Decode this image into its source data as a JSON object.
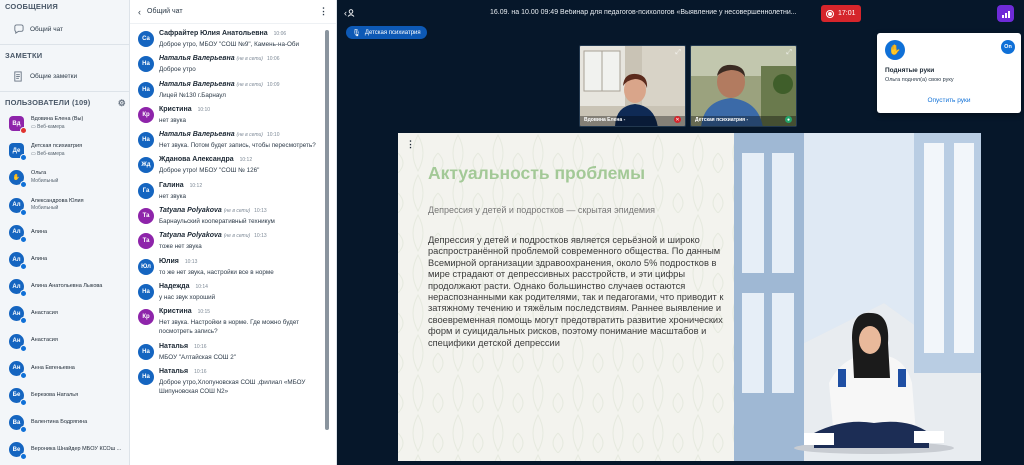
{
  "sidebar": {
    "messages_heading": "СООБЩЕНИЯ",
    "public_chat": "Общий чат",
    "notes_heading": "ЗАМЕТКИ",
    "shared_notes": "Общие заметки",
    "users_heading": "ПОЛЬЗОВАТЕЛИ (109)",
    "users": [
      {
        "initials": "Вд",
        "name": "Вдовина Елена (Вы)",
        "sub": "▭ Веб-камера",
        "color": "#8e24aa",
        "shape": "square",
        "badge": "red"
      },
      {
        "initials": "Де",
        "name": "Детская психиатрия",
        "sub": "▭ Веб-камера",
        "color": "#1565c0",
        "shape": "square",
        "badge": "blue"
      },
      {
        "initials": "✋",
        "name": "Ольга",
        "sub": "Мобильный",
        "color": "#1565c0",
        "shape": "round",
        "badge": "blue"
      },
      {
        "initials": "Ал",
        "name": "Александрова Юлия",
        "sub": "Мобильный",
        "color": "#1565c0",
        "shape": "round",
        "badge": "blue"
      },
      {
        "initials": "Ал",
        "name": "Алина",
        "sub": "",
        "color": "#1565c0",
        "shape": "round",
        "badge": "blue"
      },
      {
        "initials": "Ал",
        "name": "Алина",
        "sub": "",
        "color": "#1565c0",
        "shape": "round",
        "badge": "blue"
      },
      {
        "initials": "Ал",
        "name": "Алина Анатольевна Лыкова",
        "sub": "",
        "color": "#1565c0",
        "shape": "round",
        "badge": "blue"
      },
      {
        "initials": "Ан",
        "name": "Анастасия",
        "sub": "",
        "color": "#1565c0",
        "shape": "round",
        "badge": "blue"
      },
      {
        "initials": "Ан",
        "name": "Анастасия",
        "sub": "",
        "color": "#1565c0",
        "shape": "round",
        "badge": "blue"
      },
      {
        "initials": "Ан",
        "name": "Анна Евгеньевна",
        "sub": "",
        "color": "#1565c0",
        "shape": "round",
        "badge": "blue"
      },
      {
        "initials": "Бе",
        "name": "Березова Наталья",
        "sub": "",
        "color": "#1565c0",
        "shape": "round",
        "badge": "blue"
      },
      {
        "initials": "Ва",
        "name": "Валентина Бодрягина",
        "sub": "",
        "color": "#1565c0",
        "shape": "round",
        "badge": "blue"
      },
      {
        "initials": "Ве",
        "name": "Вероника Шнайдер МБОУ КСОш ...",
        "sub": "",
        "color": "#1565c0",
        "shape": "round",
        "badge": "blue"
      }
    ]
  },
  "chat": {
    "title": "Общий чат",
    "messages": [
      {
        "initials": "Са",
        "color": "#1565c0",
        "name": "Сафрайтер Юлия Анатольевна",
        "status": "",
        "time": "10:06",
        "text": "Доброе утро, МБОУ \"СОШ №9\", Камень-на-Оби",
        "italic": false
      },
      {
        "initials": "На",
        "color": "#1565c0",
        "name": "Наталья Валерьевна",
        "status": "(не в сети)",
        "time": "10:06",
        "text": "Доброе утро",
        "italic": true
      },
      {
        "initials": "На",
        "color": "#1565c0",
        "name": "Наталья Валерьевна",
        "status": "(не в сети)",
        "time": "10:09",
        "text": "Лицей №130 г.Барнаул",
        "italic": true
      },
      {
        "initials": "Кр",
        "color": "#8e24aa",
        "name": "Кристина",
        "status": "",
        "time": "10:10",
        "text": "нет звука",
        "italic": false
      },
      {
        "initials": "На",
        "color": "#1565c0",
        "name": "Наталья Валерьевна",
        "status": "(не в сети)",
        "time": "10:10",
        "text": "Нет звука. Потом будет запись, чтобы пересмотреть?",
        "italic": true
      },
      {
        "initials": "Жд",
        "color": "#1565c0",
        "name": "Жданова Александра",
        "status": "",
        "time": "10:12",
        "text": "Доброе утро! МБОУ \"СОШ № 126\"",
        "italic": false
      },
      {
        "initials": "Га",
        "color": "#1565c0",
        "name": "Галина",
        "status": "",
        "time": "10:12",
        "text": "нет звука",
        "italic": false
      },
      {
        "initials": "Та",
        "color": "#8e24aa",
        "name": "Tatyana Polyakova",
        "status": "(не в сети)",
        "time": "10:13",
        "text": "Барнаульский кооперативный техникум",
        "italic": true
      },
      {
        "initials": "Та",
        "color": "#8e24aa",
        "name": "Tatyana Polyakova",
        "status": "(не в сети)",
        "time": "10:13",
        "text": "тоже нет звука",
        "italic": true
      },
      {
        "initials": "Юл",
        "color": "#1565c0",
        "name": "Юлия",
        "status": "",
        "time": "10:13",
        "text": "то же нет звука, настройки все в норме",
        "italic": false
      },
      {
        "initials": "На",
        "color": "#1565c0",
        "name": "Надежда",
        "status": "",
        "time": "10:14",
        "text": "у нас звук хороший",
        "italic": false
      },
      {
        "initials": "Кр",
        "color": "#8e24aa",
        "name": "Кристина",
        "status": "",
        "time": "10:15",
        "text": "Нет звука. Настройки в норме. Где можно будет посмотреть запись?",
        "italic": false
      },
      {
        "initials": "На",
        "color": "#1565c0",
        "name": "Наталья",
        "status": "",
        "time": "10:16",
        "text": "МБОУ \"Алтайская СОШ 2\"",
        "italic": false
      },
      {
        "initials": "На",
        "color": "#1565c0",
        "name": "Наталья",
        "status": "",
        "time": "10:16",
        "text": "Доброе утро,Хлопуновская СОШ ,филиал «МБОУ Шипуновская СОШ N2»",
        "italic": false
      }
    ]
  },
  "topbar": {
    "meeting_title": "16.09. на 10.00 09:49 Вебинар для педагогов-психологов «Выявление у несовершеннолетни...",
    "recording_time": "17:01",
    "presenter_badge": "Детская психиатрия"
  },
  "tiles": [
    {
      "name": "Вдовина Елена -",
      "mic": "muted"
    },
    {
      "name": "Детская психиатрия -",
      "mic": "on"
    }
  ],
  "raise_hand_popup": {
    "toggle": "On",
    "title": "Поднятые руки",
    "text": "Ольга поднял(а) свою руку",
    "link": "Опустить руки"
  },
  "slide": {
    "title": "Актуальность проблемы",
    "subtitle": "Депрессия у детей и подростков — скрытая эпидемия",
    "body": "Депрессия у детей и подростков является серьёзной и широко распространённой проблемой современного общества. По данным Всемирной организации здравоохранения, около 5% подростков в мире страдают от депрессивных расстройств, и эти цифры продолжают расти. Однако большинство случаев остаются нераспознанными как родителями, так и педагогами, что приводит к затяжному течению и тяжёлым последствиям. Раннее выявление и своевременная помощь могут предотвратить развитие хронических форм и суицидальных рисков, поэтому понимание масштабов и специфики детской депрессии"
  },
  "colors": {
    "accent": "#0f70d7",
    "record": "#d5252b",
    "slide_title": "#a3c997",
    "main_bg": "#06172a"
  }
}
